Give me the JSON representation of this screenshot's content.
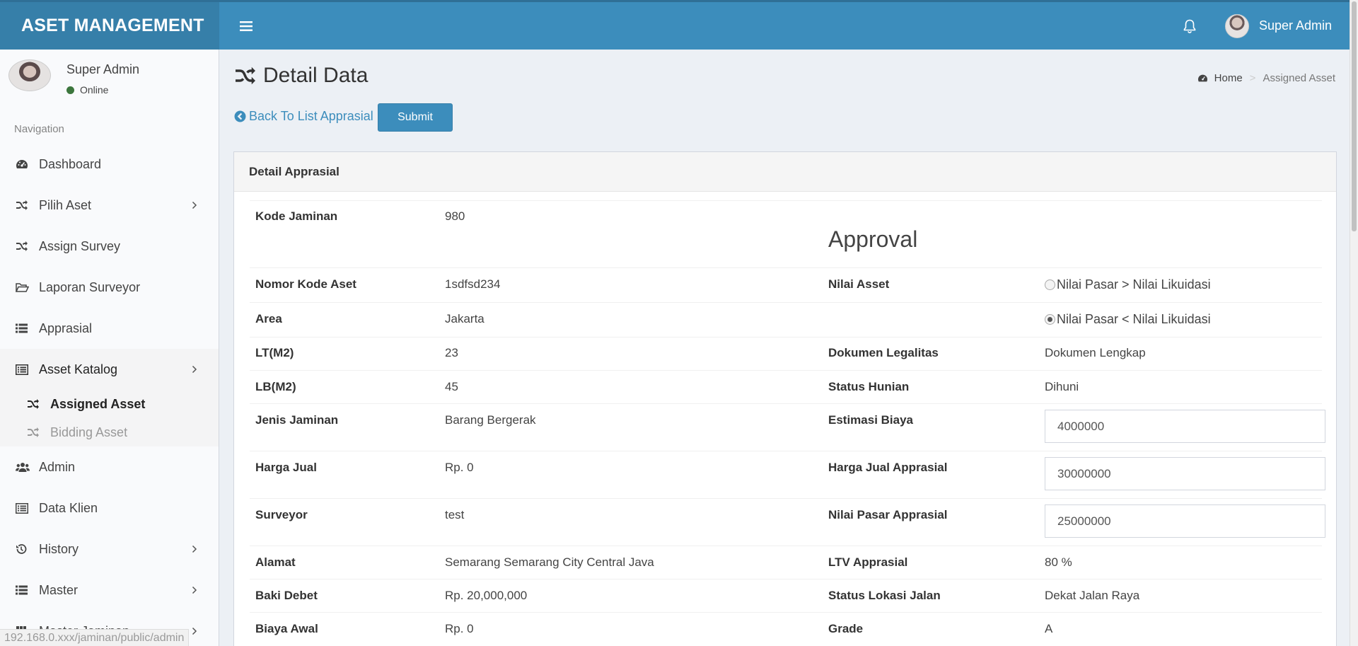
{
  "header": {
    "brand": "ASET MANAGEMENT",
    "user_name": "Super Admin"
  },
  "sidebar": {
    "user_name": "Super Admin",
    "status": "Online",
    "nav_header": "Navigation",
    "items": [
      {
        "label": "Dashboard",
        "icon": "dashboard-icon"
      },
      {
        "label": "Pilih Aset",
        "icon": "random-icon"
      },
      {
        "label": "Assign Survey",
        "icon": "random-icon"
      },
      {
        "label": "Laporan Surveyor",
        "icon": "folder-open-icon"
      },
      {
        "label": "Apprasial",
        "icon": "list-icon"
      },
      {
        "label": "Asset Katalog",
        "icon": "list-alt-icon"
      },
      {
        "label": "Admin",
        "icon": "users-icon"
      },
      {
        "label": "Data Klien",
        "icon": "list-alt-icon"
      },
      {
        "label": "History",
        "icon": "history-icon"
      },
      {
        "label": "Master",
        "icon": "list-icon"
      },
      {
        "label": "Master Jaminan",
        "icon": "th-icon"
      }
    ],
    "sub_items": [
      {
        "label": "Assigned Asset"
      },
      {
        "label": "Bidding Asset"
      }
    ]
  },
  "page": {
    "title": "Detail Data",
    "breadcrumb_home": "Home",
    "breadcrumb_current": "Assigned Asset",
    "back_link": "Back To List Apprasial",
    "submit": "Submit"
  },
  "box": {
    "title": "Detail Apprasial",
    "approval_heading": "Approval",
    "left": [
      {
        "label": "Kode Jaminan",
        "value": "980"
      },
      {
        "label": "Nomor Kode Aset",
        "value": "1sdfsd234"
      },
      {
        "label": "Area",
        "value": "Jakarta"
      },
      {
        "label": "LT(M2)",
        "value": "23"
      },
      {
        "label": "LB(M2)",
        "value": "45"
      },
      {
        "label": "Jenis Jaminan",
        "value": "Barang Bergerak"
      },
      {
        "label": "Harga Jual",
        "value": "Rp. 0"
      },
      {
        "label": "Surveyor",
        "value": "test"
      },
      {
        "label": "Alamat",
        "value": "Semarang Semarang City Central Java"
      },
      {
        "label": "Baki Debet",
        "value": "Rp. 20,000,000"
      },
      {
        "label": "Biaya Awal",
        "value": "Rp. 0"
      }
    ],
    "right": {
      "nilai_asset_label": "Nilai Asset",
      "radio_1": "Nilai Pasar > Nilai Likuidasi",
      "radio_2": "Nilai Pasar < Nilai Likuidasi",
      "selected_radio": 2,
      "dokumen_label": "Dokumen Legalitas",
      "dokumen_value": "Dokumen Lengkap",
      "hunian_label": "Status Hunian",
      "hunian_value": "Dihuni",
      "estimasi_label": "Estimasi Biaya",
      "estimasi_value": "4000000",
      "harga_jual_label": "Harga Jual Apprasial",
      "harga_jual_value": "30000000",
      "nilai_pasar_label": "Nilai Pasar Apprasial",
      "nilai_pasar_value": "25000000",
      "ltv_label": "LTV Apprasial",
      "ltv_value": "80 %",
      "lokasi_label": "Status Lokasi Jalan",
      "lokasi_value": "Dekat Jalan Raya",
      "grade_label": "Grade",
      "grade_value": "A"
    }
  },
  "status_bar": {
    "url": "192.168.0.xxx/jaminan/public/admin"
  }
}
